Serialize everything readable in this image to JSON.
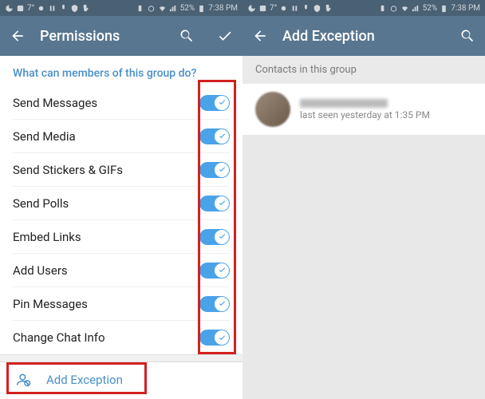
{
  "status": {
    "time": "7:38 PM",
    "battery": "52%",
    "temp": "7°"
  },
  "left": {
    "title": "Permissions",
    "section": "What can members of this group do?",
    "perms": [
      "Send Messages",
      "Send Media",
      "Send Stickers & GIFs",
      "Send Polls",
      "Embed Links",
      "Add Users",
      "Pin Messages",
      "Change Chat Info"
    ],
    "add_exception": "Add Exception"
  },
  "right": {
    "title": "Add Exception",
    "group_header": "Contacts in this group",
    "contact_status": "last seen yesterday at 1:35 PM"
  }
}
